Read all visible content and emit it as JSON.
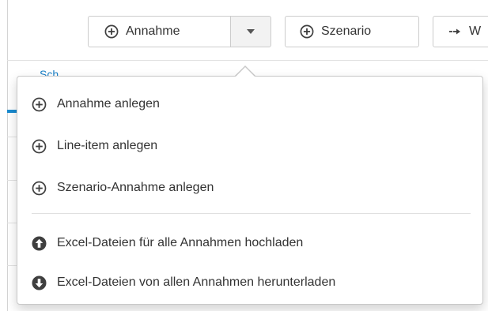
{
  "toolbar": {
    "annahme_button": {
      "label": "Annahme",
      "icon": "circle-plus-icon"
    },
    "caret_button": {
      "icon": "caret-down-icon"
    },
    "szenario_button": {
      "label": "Szenario",
      "icon": "circle-plus-icon"
    },
    "weitere_button": {
      "label": "W",
      "icon": "arrow-right-icon"
    }
  },
  "background": {
    "tab_text": "Sch..."
  },
  "dropdown": {
    "items": [
      {
        "label": "Annahme anlegen",
        "icon": "circle-plus-icon"
      },
      {
        "label": "Line-item anlegen",
        "icon": "circle-plus-icon"
      },
      {
        "label": "Szenario-Annahme anlegen",
        "icon": "circle-plus-icon"
      },
      {
        "label": "Excel-Dateien für alle Annahmen hochladen",
        "icon": "circle-arrow-up-icon"
      },
      {
        "label": "Excel-Dateien von allen Annahmen herunterladen",
        "icon": "circle-arrow-down-icon"
      }
    ]
  },
  "colors": {
    "text": "#333333",
    "border": "#cccccc",
    "accent": "#1a8bd0",
    "icon_dark": "#3f3f3f"
  }
}
